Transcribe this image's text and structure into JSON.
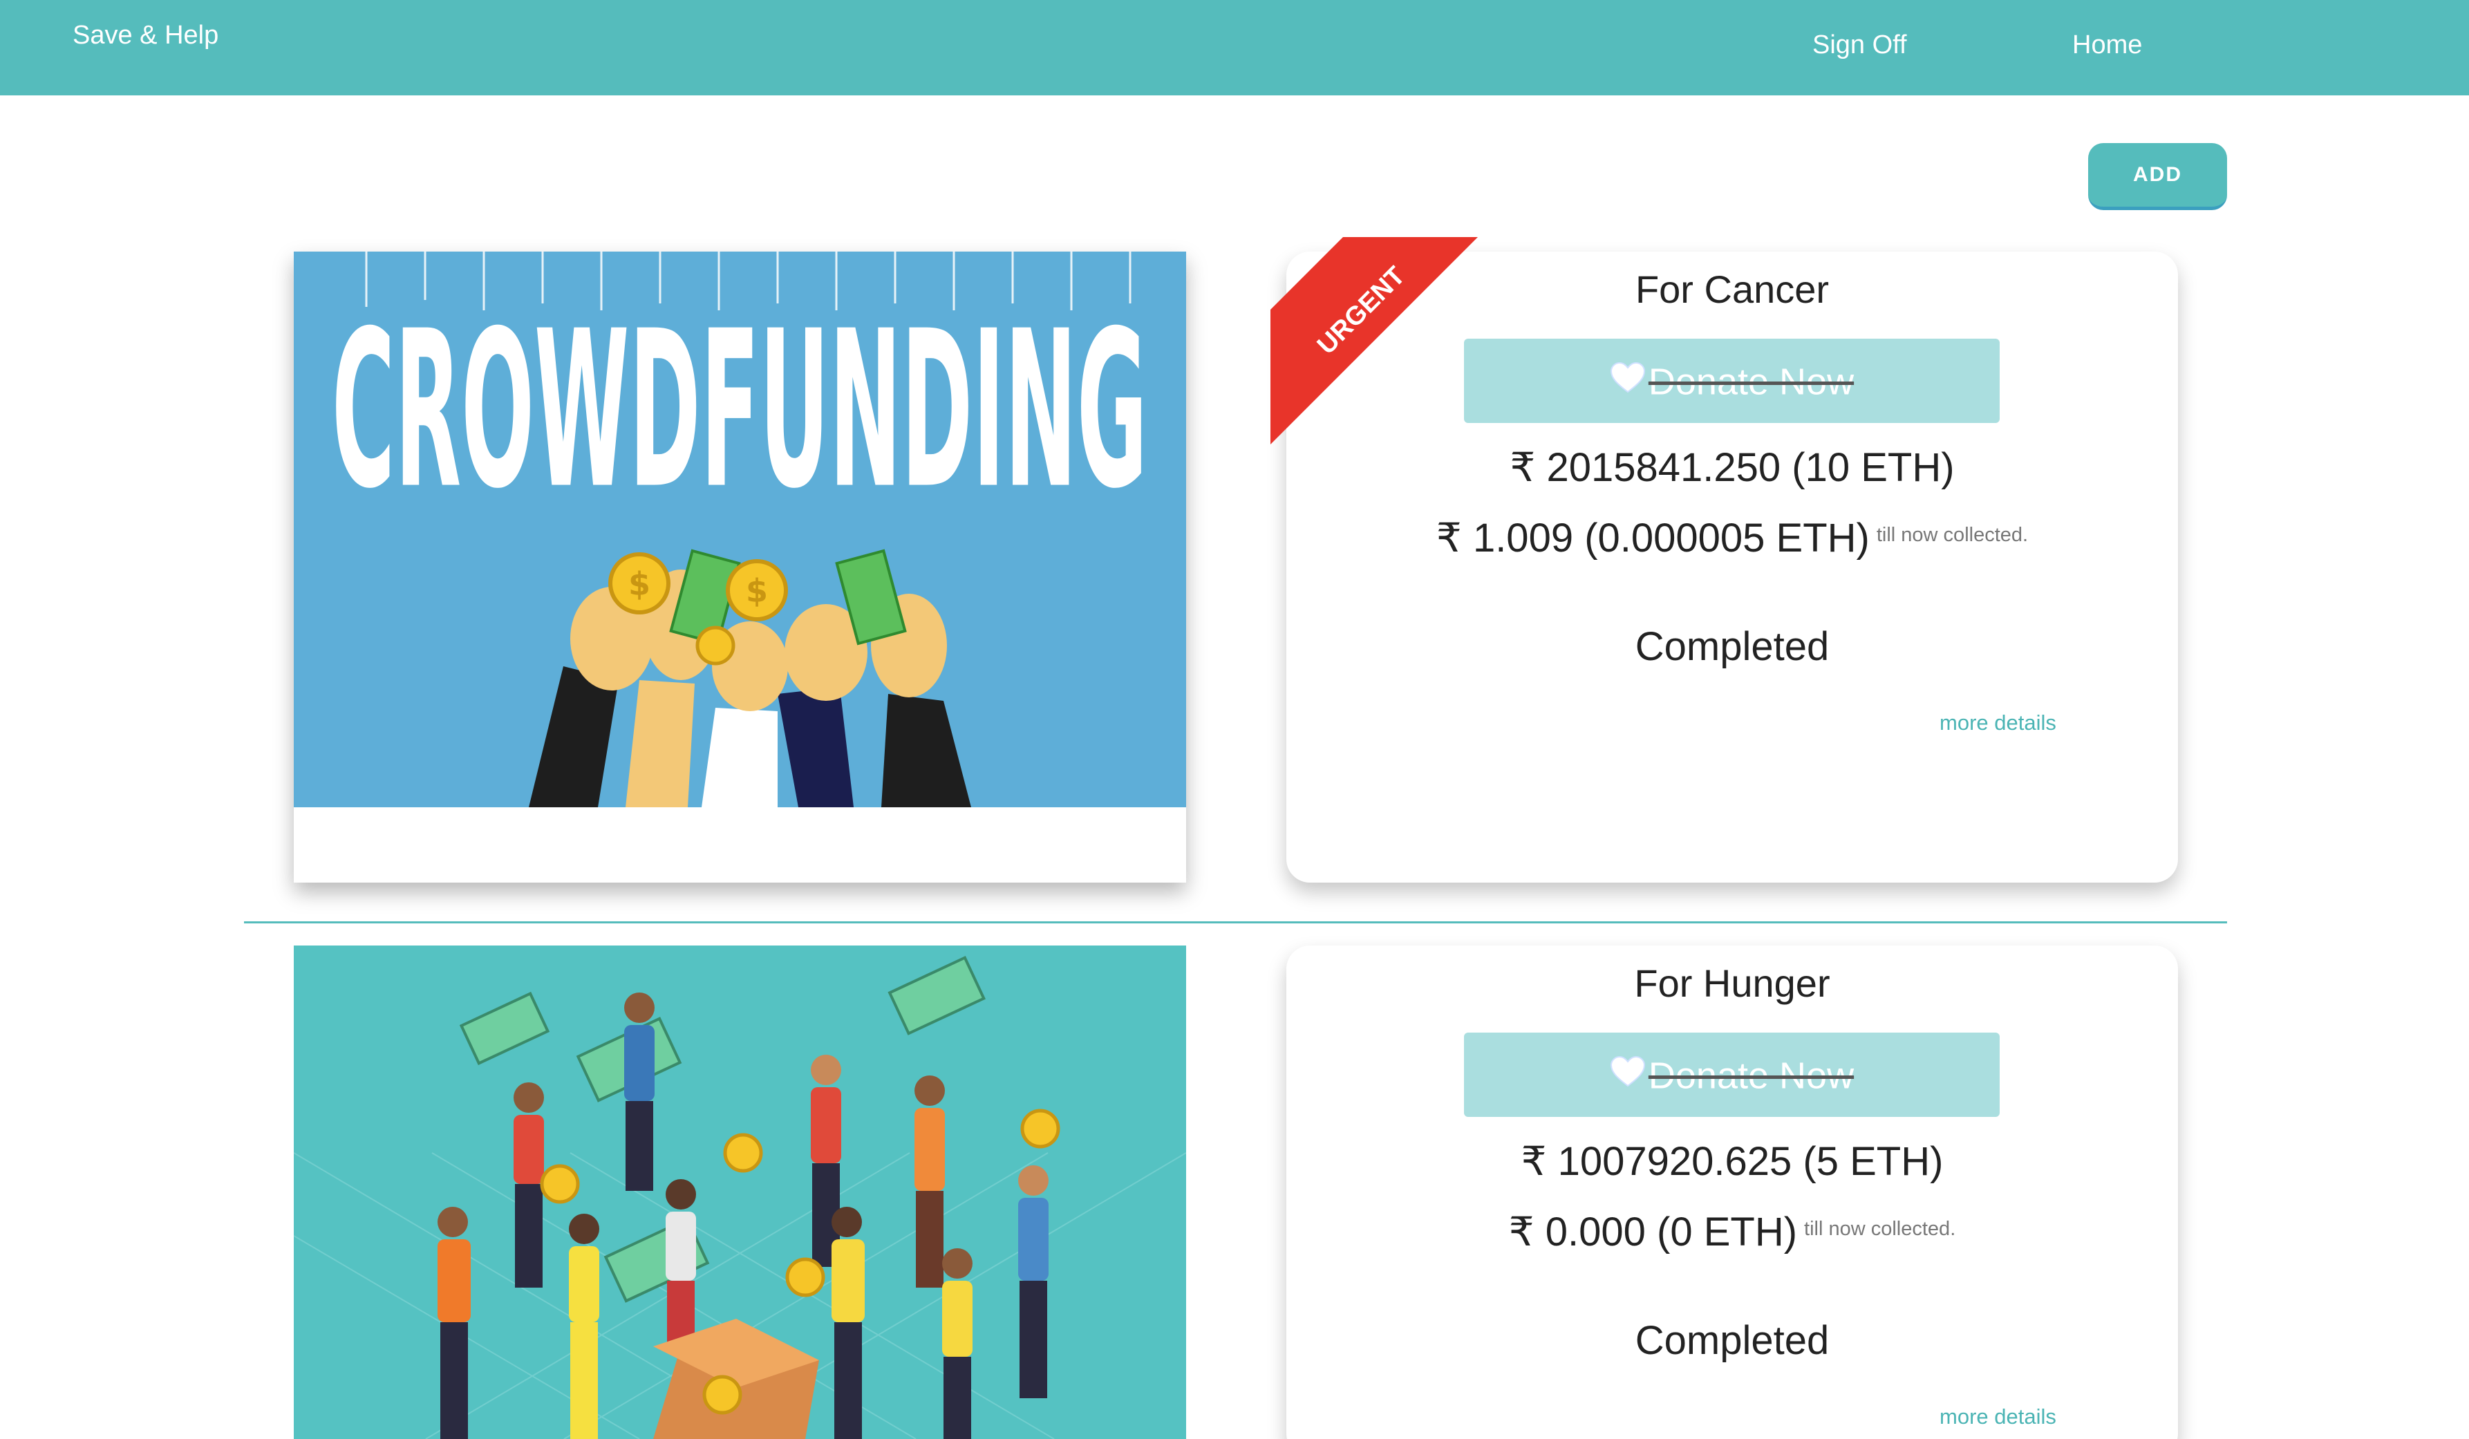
{
  "navbar": {
    "brand": "Save & Help",
    "sign_off": "Sign Off",
    "home": "Home",
    "color": "#55bcbc"
  },
  "add_button": {
    "label": "ADD"
  },
  "campaigns": [
    {
      "title": "For Cancer",
      "urgent_label": "URGENT",
      "image_text": "CROWDFUNDING",
      "donate_label": "Donate Now",
      "goal": "₹ 2015841.250 (10 ETH)",
      "collected": "₹ 1.009 (0.000005 ETH)",
      "collected_note": "till now collected.",
      "status": "Completed",
      "more_details": "more details"
    },
    {
      "title": "For Hunger",
      "donate_label": "Donate Now",
      "goal": "₹ 1007920.625 (5 ETH)",
      "collected": "₹ 0.000 (0 ETH)",
      "collected_note": "till now collected.",
      "status": "Completed",
      "more_details": "more details"
    }
  ],
  "colors": {
    "accent": "#55bcbc",
    "donate_button": "#aadedf",
    "urgent_ribbon": "#e8342a",
    "image_blue": "#5eaed8",
    "image_teal": "#55c2c2"
  }
}
